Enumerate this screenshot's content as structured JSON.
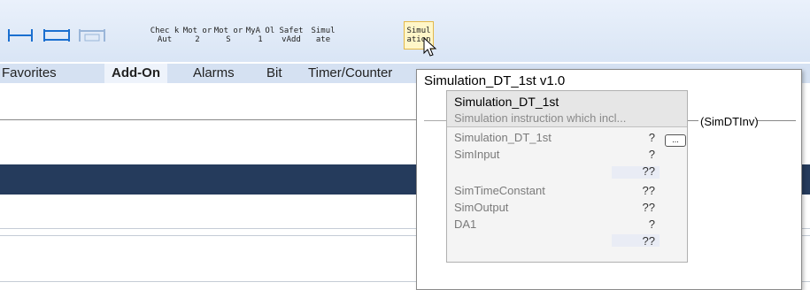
{
  "toolbar": {
    "buttons": [
      {
        "label": "Chec kAut"
      },
      {
        "label": "Mot or 2"
      },
      {
        "label": "Mot or S"
      },
      {
        "label": "MyA Ol1"
      },
      {
        "label": "Safet vAdd"
      },
      {
        "label": "Simul ate"
      },
      {
        "label": "Simul ation"
      }
    ]
  },
  "tabs": [
    "Favorites",
    "Add-On",
    "Alarms",
    "Bit",
    "Timer/Counter"
  ],
  "popup": {
    "title": "Simulation_DT_1st v1.0",
    "instruction": {
      "name": "Simulation_DT_1st",
      "description": "Simulation instruction which incl...",
      "dots_label": "...",
      "output_coil": "SimDTInv",
      "rows": [
        {
          "label": "Simulation_DT_1st",
          "value": "?"
        },
        {
          "label": "SimInput",
          "value": "?"
        },
        {
          "label": "",
          "value": "??"
        },
        {
          "label": "SimTimeConstant",
          "value": "??"
        },
        {
          "label": "SimOutput",
          "value": "??"
        },
        {
          "label": "DA1",
          "value": "?"
        },
        {
          "label": "",
          "value": "??"
        }
      ]
    }
  }
}
